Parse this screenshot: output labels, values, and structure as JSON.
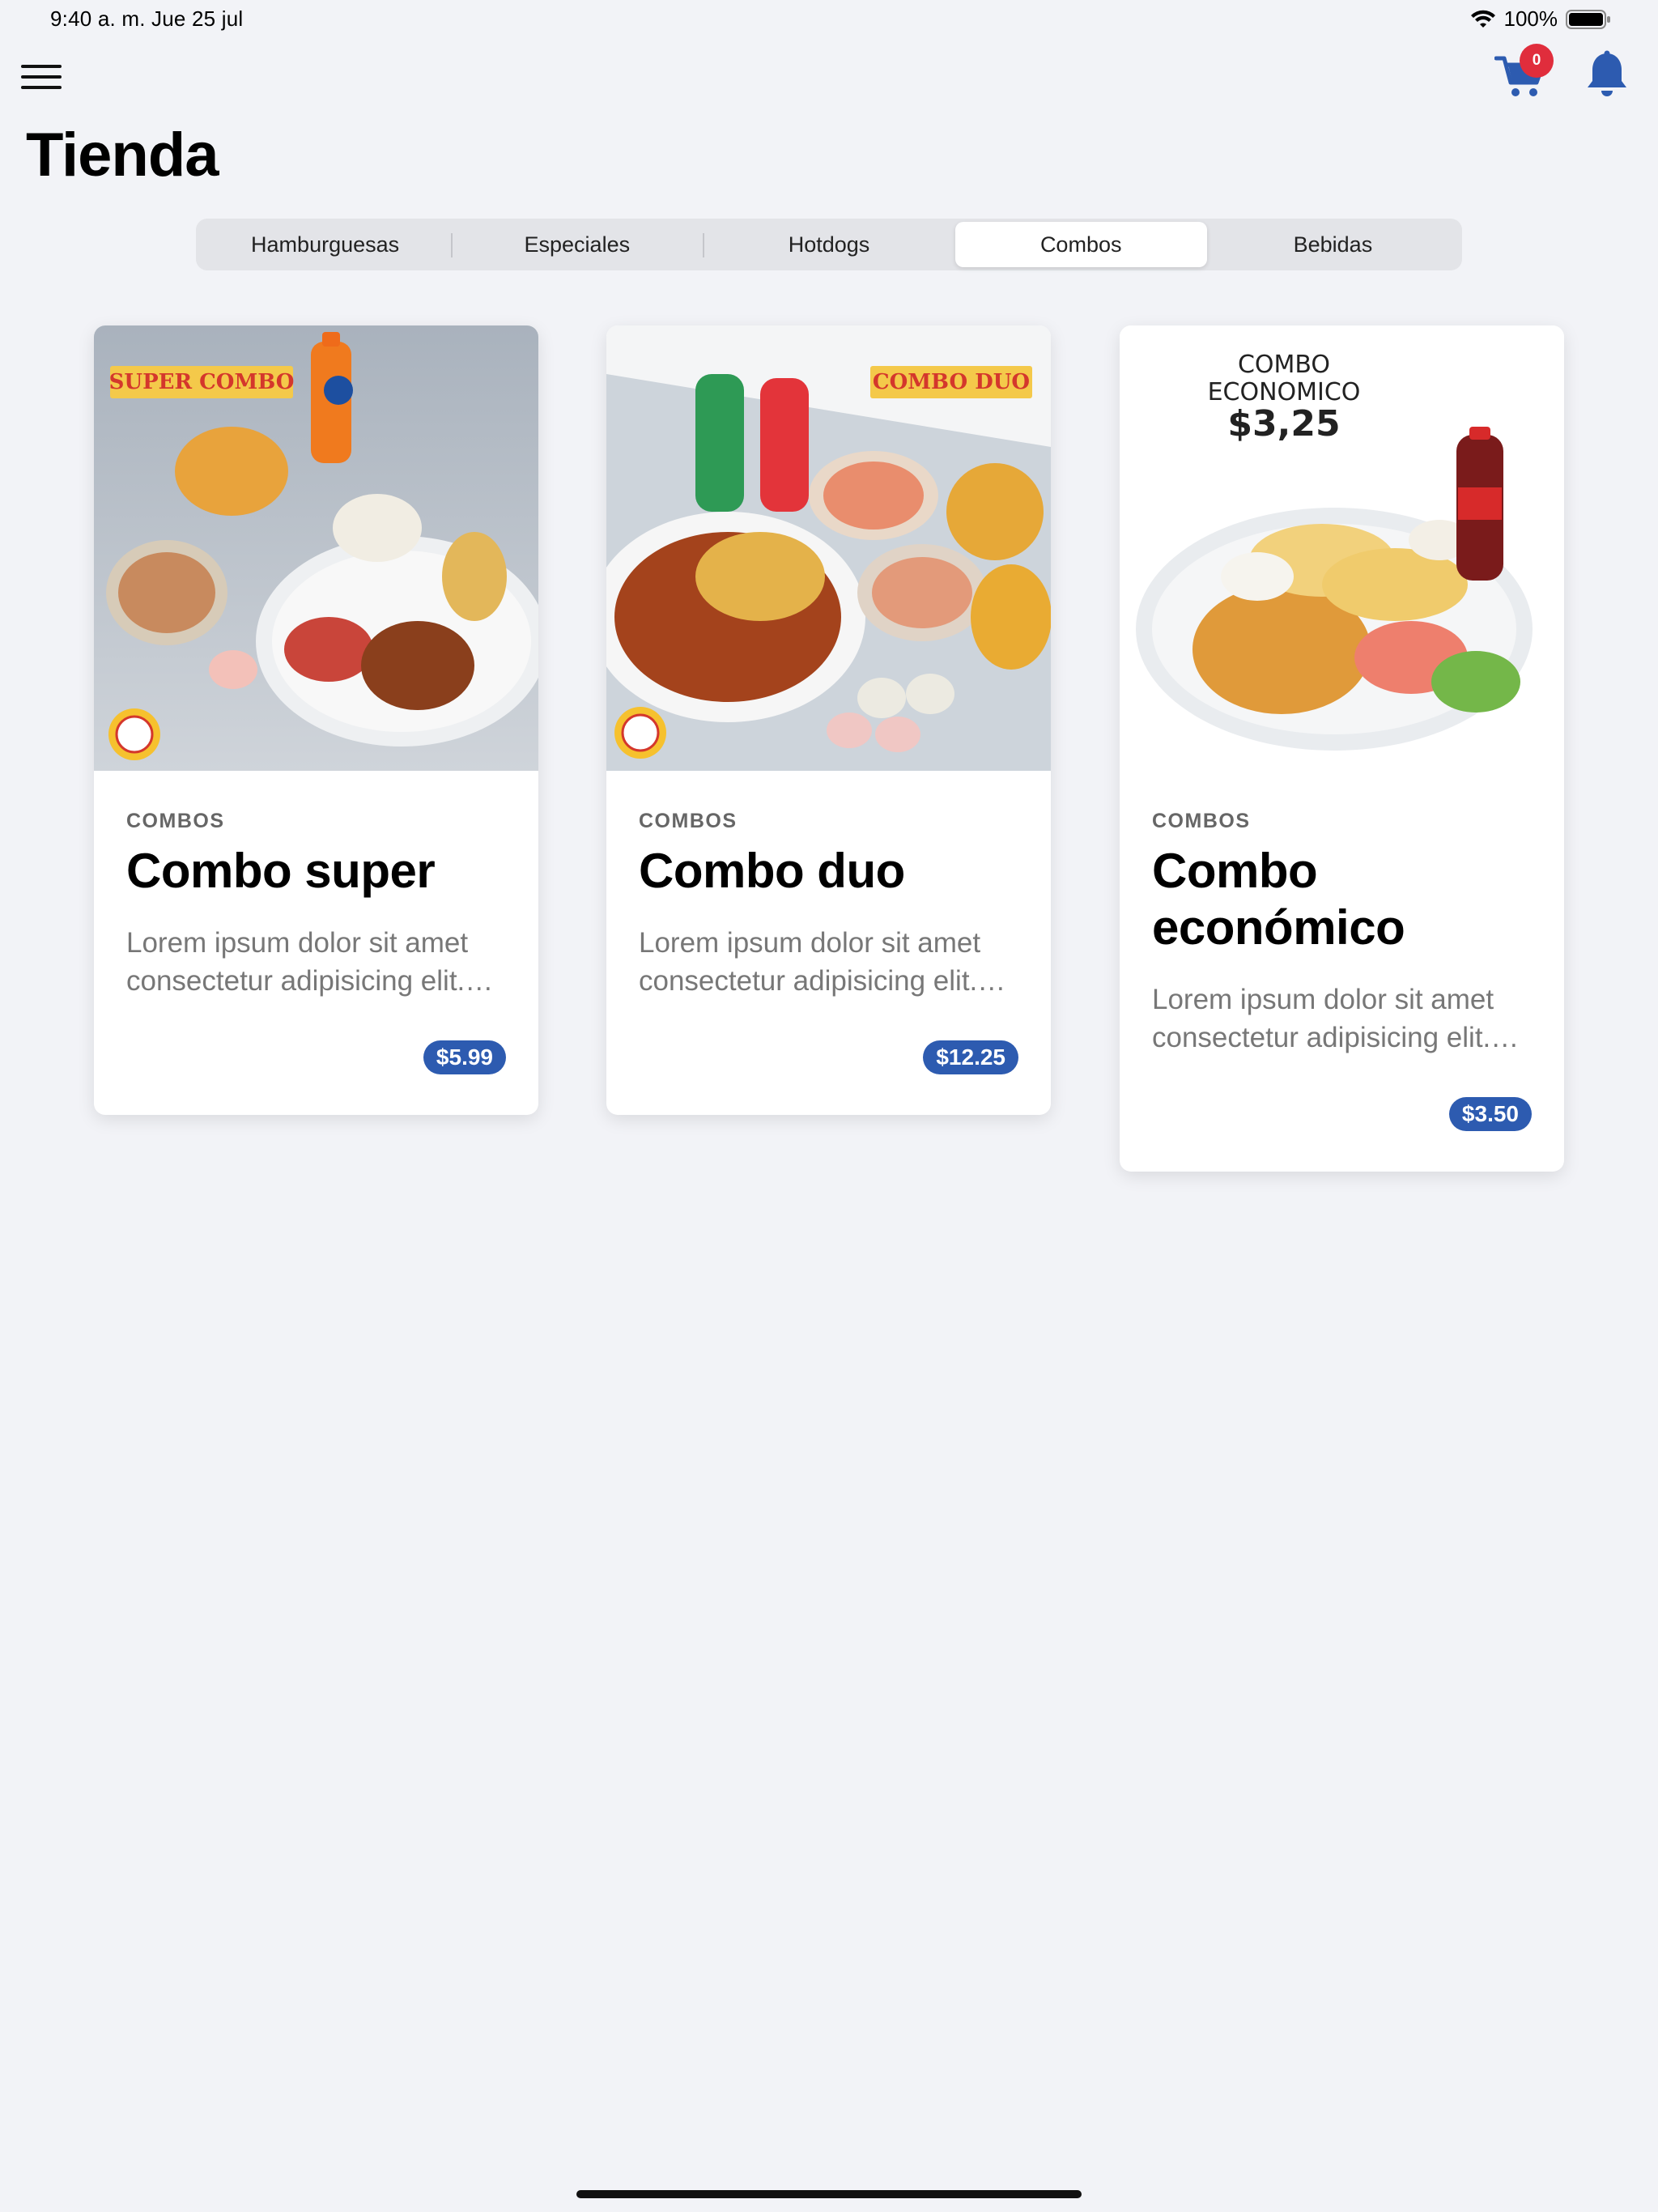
{
  "status_bar": {
    "time": "9:40 a. m.   Jue 25 jul",
    "battery": "100%"
  },
  "header": {
    "title": "Tienda",
    "cart_count": "0",
    "accent_color": "#2d5bb0",
    "badge_color": "#e02d3c"
  },
  "tabs": [
    {
      "label": "Hamburguesas",
      "active": false
    },
    {
      "label": "Especiales",
      "active": false
    },
    {
      "label": "Hotdogs",
      "active": false
    },
    {
      "label": "Combos",
      "active": true
    },
    {
      "label": "Bebidas",
      "active": false
    }
  ],
  "products": [
    {
      "category": "COMBOS",
      "name": "Combo super",
      "description": "Lorem ipsum dolor sit amet consectetur adipisicing elit. Iure, quasi.",
      "price": "$5.99",
      "image_label": "SUPER COMBO"
    },
    {
      "category": "COMBOS",
      "name": "Combo duo",
      "description": "Lorem ipsum dolor sit amet consectetur adipisicing elit. Iure, quasi.",
      "price": "$12.25",
      "image_label": "COMBO DUO"
    },
    {
      "category": "COMBOS",
      "name": "Combo económico",
      "description": "Lorem ipsum dolor sit amet consectetur adipisicing elit. Iure, quasi.",
      "price": "$3.50",
      "image_label_line1": "COMBO",
      "image_label_line2": "ECONOMICO",
      "image_price": "$3,25"
    }
  ]
}
